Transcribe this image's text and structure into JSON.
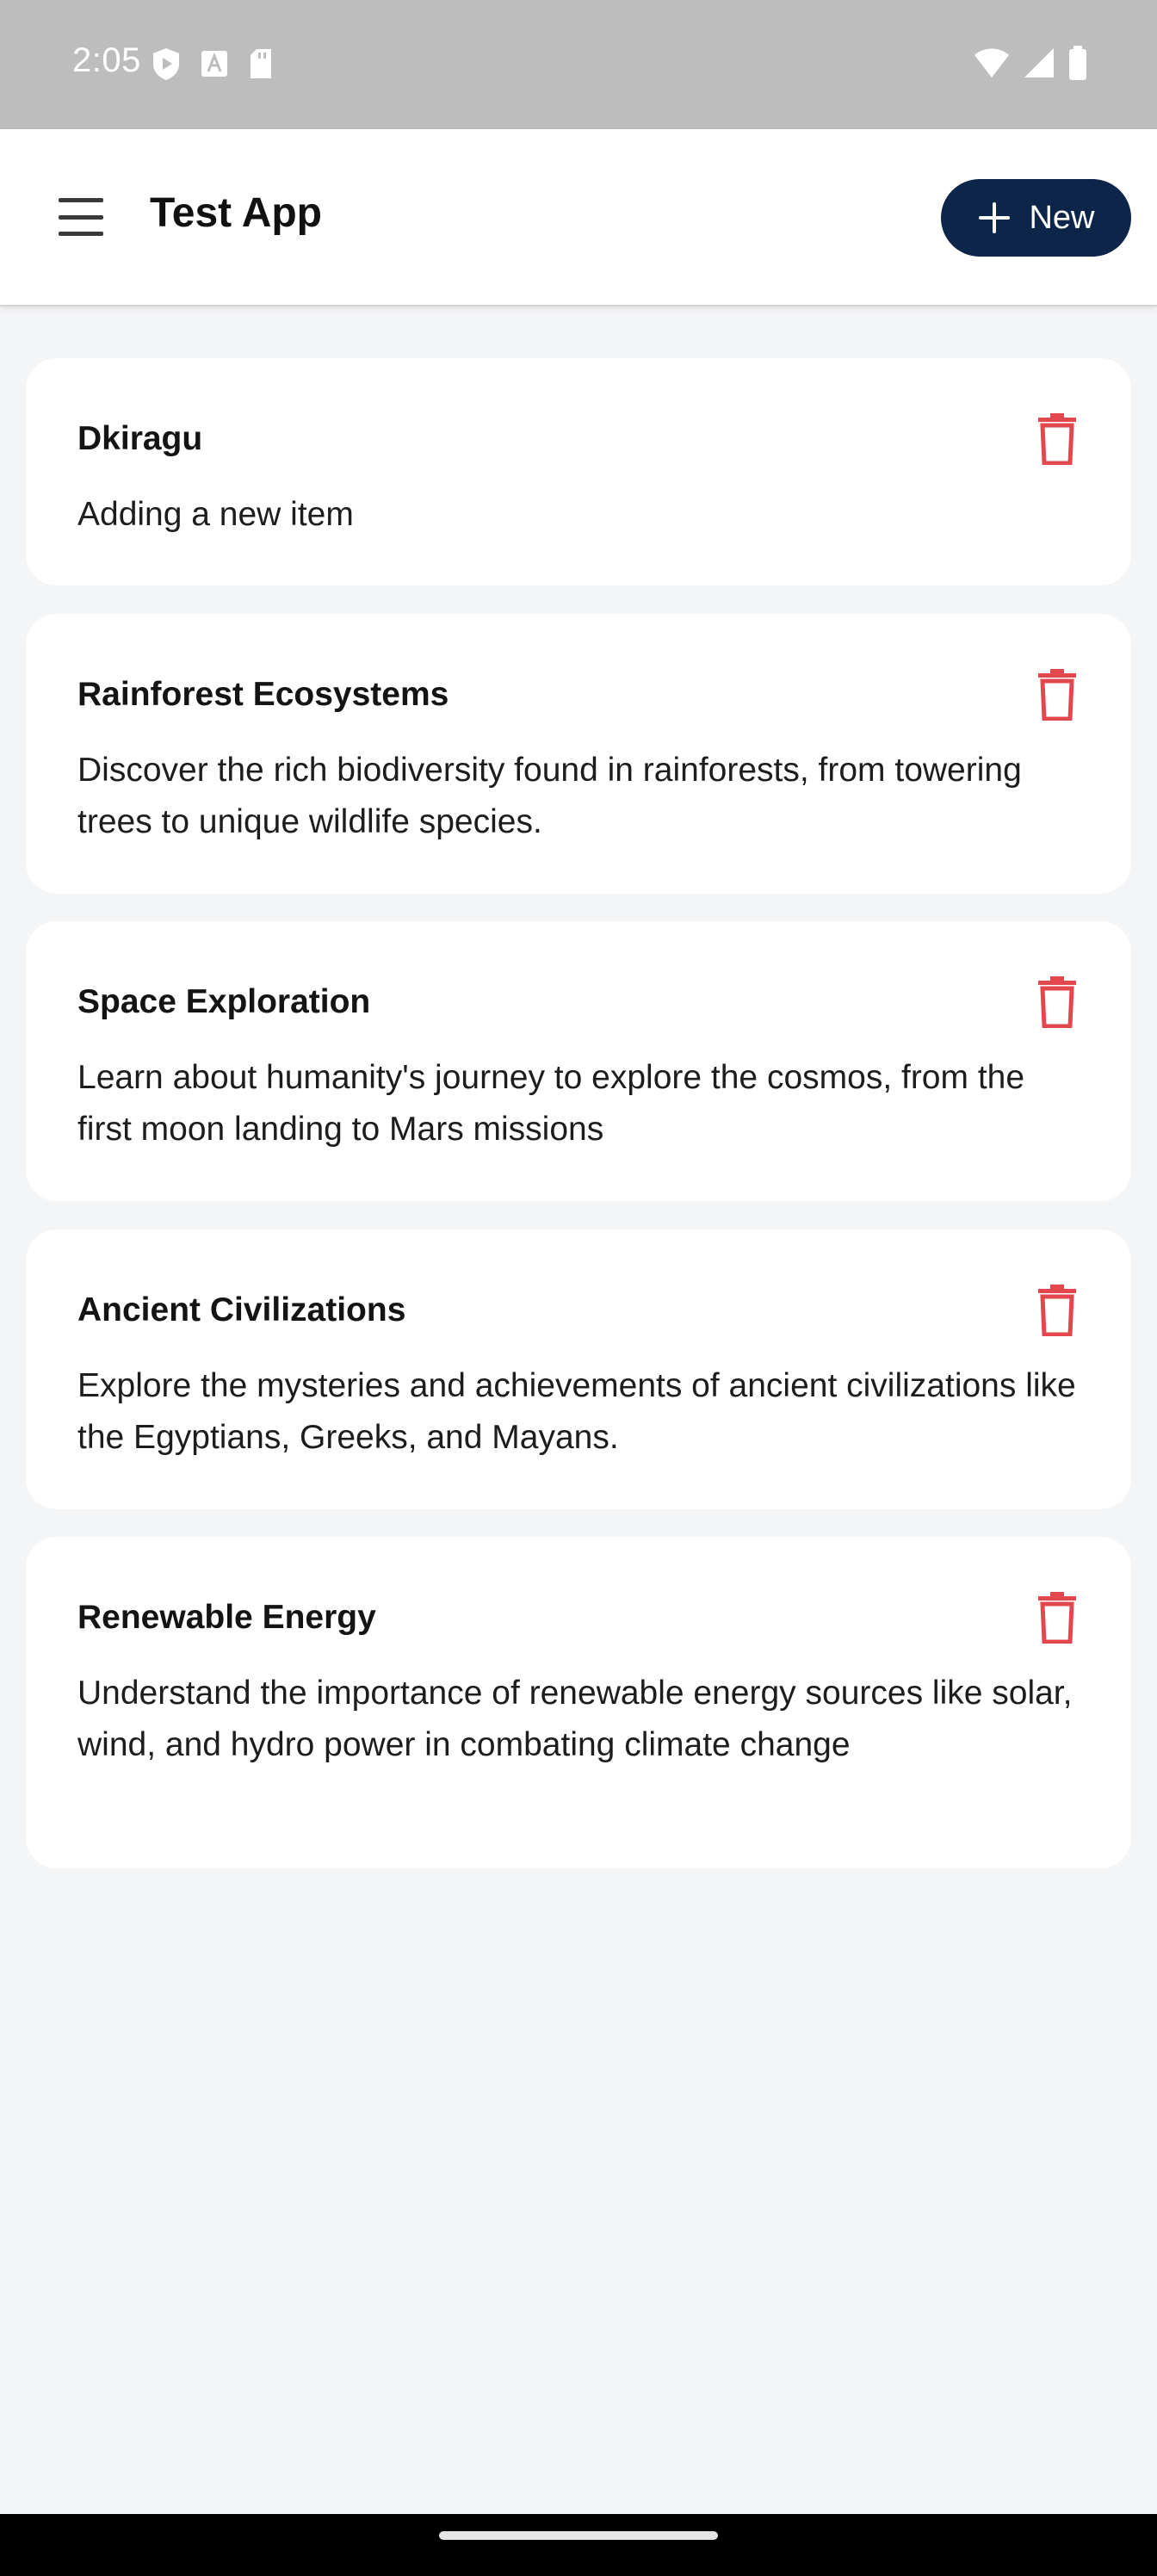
{
  "status_bar": {
    "time": "2:05",
    "left_icons": [
      "play-shield-icon",
      "a-square-icon",
      "sd-card-icon"
    ],
    "right_icons": [
      "wifi-icon",
      "signal-icon",
      "battery-icon"
    ]
  },
  "app_bar": {
    "menu_icon": "hamburger-menu-icon",
    "title": "Test App",
    "new_button": {
      "label": "New",
      "icon": "plus-icon"
    }
  },
  "items": [
    {
      "title": "Dkiragu",
      "description": "Adding a new item"
    },
    {
      "title": "Rainforest Ecosystems",
      "description": "Discover the rich biodiversity found in rainforests, from towering trees to unique wildlife species."
    },
    {
      "title": "Space Exploration",
      "description": "Learn about humanity's journey to explore the cosmos, from the first moon landing to Mars missions"
    },
    {
      "title": "Ancient Civilizations",
      "description": "Explore the mysteries and achievements of ancient civilizations like the Egyptians, Greeks, and Mayans."
    },
    {
      "title": "Renewable Energy",
      "description": "Understand the importance of renewable energy sources like solar, wind, and hydro power in combating climate change"
    }
  ],
  "colors": {
    "brand_dark": "#0c2549",
    "delete_red": "#e2484d",
    "background": "#f4f5f7",
    "card": "#ffffff"
  }
}
